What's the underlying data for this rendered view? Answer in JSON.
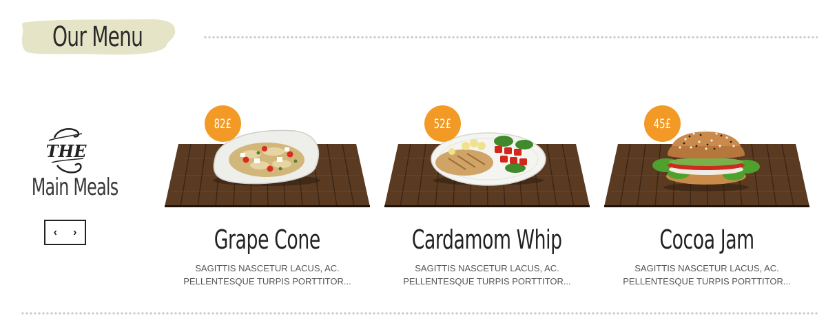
{
  "header": {
    "title": "Our Menu"
  },
  "category": {
    "ornament_word": "THE",
    "title": "Main Meals",
    "prev_label": "‹",
    "next_label": "›"
  },
  "items": [
    {
      "name": "Grape Cone",
      "price": "82£",
      "desc_line1": "Sagittis nascetur lacus, ac.",
      "desc_line2": "pellentesque turpis porttitor...",
      "dish": "pasta"
    },
    {
      "name": "Cardamom Whip",
      "price": "52£",
      "desc_line1": "Sagittis nascetur lacus, ac.",
      "desc_line2": "pellentesque turpis porttitor...",
      "dish": "chicken-salad"
    },
    {
      "name": "Cocoa Jam",
      "price": "45£",
      "desc_line1": "Sagittis nascetur lacus, ac.",
      "desc_line2": "pellentesque turpis porttitor...",
      "dish": "bagel"
    }
  ],
  "colors": {
    "accent": "#f39a26",
    "badge_bg": "#e6e4c6",
    "wood": "#5a3b22",
    "dots": "#c9c9c9"
  }
}
